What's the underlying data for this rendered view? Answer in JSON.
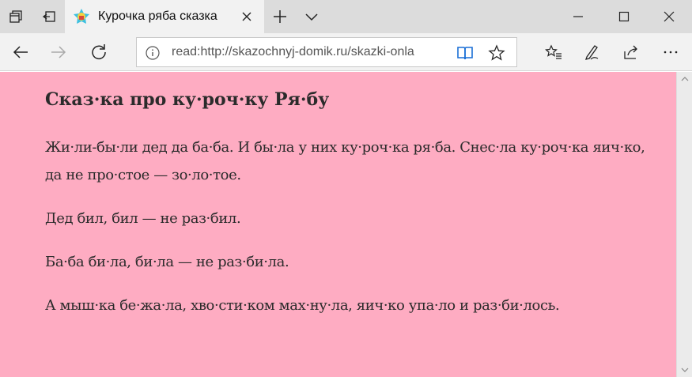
{
  "tab": {
    "title": "Курочка ряба сказка"
  },
  "address_bar": {
    "url": "read:http://skazochnyj-domik.ru/skazki-onla"
  },
  "article": {
    "title": "Сказ·ка про ку·роч·ку Ря·бу",
    "paragraphs": [
      "Жи·ли-бы·ли дед да ба·ба. И бы·ла у них ку·роч·ка ря·ба. Снес·ла ку·роч·ка яич·ко, да не про·стое — зо·ло·тое.",
      "Дед бил, бил — не раз·бил.",
      "Ба·ба би·ла, би·ла — не раз·би·ла.",
      "А мыш·ка бе·жа·ла, хво·сти·ком мах·ну·ла, яич·ко упа·ло и раз·би·лось."
    ]
  },
  "colors": {
    "reading_background": "#feacc2",
    "tabbar_background": "#dcdcdc",
    "toolbar_background": "#f2f2f2"
  },
  "icons": {
    "tab_actions": [
      "tabs-aside-icon",
      "restore-tabs-icon"
    ],
    "favicon": "house-favicon",
    "navigation": [
      "back-arrow-icon",
      "forward-arrow-icon",
      "refresh-icon"
    ],
    "address": [
      "info-icon",
      "reading-view-book-icon",
      "favorite-star-icon"
    ],
    "toolbar": [
      "favorites-hub-icon",
      "notes-pen-icon",
      "share-icon",
      "more-dots-icon"
    ],
    "window": [
      "minimize-icon",
      "maximize-icon",
      "close-window-icon"
    ]
  }
}
